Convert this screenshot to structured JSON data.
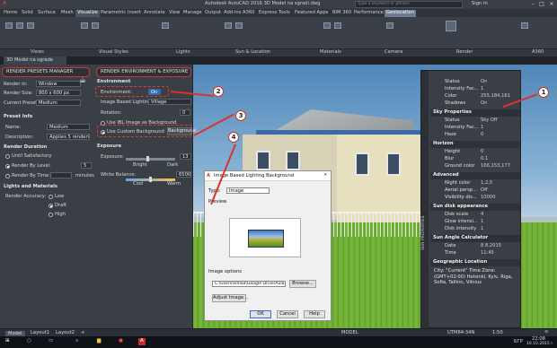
{
  "app": {
    "title": "Autodesk AutoCAD 2016    3D Model na sgradi.dwg",
    "search_placeholder": "Type a keyword or phrase",
    "user": "Sign In"
  },
  "ribbon_tabs": [
    "Home",
    "Solid",
    "Surface",
    "Mesh",
    "Visualize",
    "Parametric",
    "Insert",
    "Annotate",
    "View",
    "Manage",
    "Output",
    "Add-ins",
    "A360",
    "Express Tools",
    "Featured Apps",
    "BIM 360",
    "Performance",
    "Geolocation"
  ],
  "active_tab": "Visualize",
  "ribbon_panels": [
    "Views",
    "Visual Styles",
    "Lights",
    "Sun & Location",
    "Materials",
    "Camera",
    "Render",
    "A360"
  ],
  "doc_tab": "3D Model na sgrade",
  "render_palette": {
    "header_left": "RENDER PRESETS MANAGER",
    "header_right": "RENDER ENVIRONMENT & EXPOSURE",
    "render_in_label": "Render in:",
    "render_in_value": "Window",
    "render_size_label": "Render Size:",
    "render_size_value": "800 x 600 px",
    "current_preset_label": "Current Preset:",
    "current_preset_value": "Medium",
    "preset_info_label": "Preset Info",
    "name_label": "Name:",
    "name_value": "Medium",
    "description_label": "Description:",
    "description_value": "Applies 5 rendering levels",
    "render_duration_label": "Render Duration",
    "until_satisfactory": "Until Satisfactory",
    "render_by_level": "Render By Level:",
    "render_level_value": "5",
    "render_by_time": "Render By Time:",
    "minutes": "minutes",
    "lights_materials_label": "Lights and Materials",
    "render_accuracy_label": "Render Accuracy:",
    "accuracy_low": "Low",
    "accuracy_draft": "Draft",
    "accuracy_high": "High",
    "environment_section": "Environment",
    "environment_label": "Environment:",
    "environment_value": "On",
    "ibl_label": "Image Based Lighting:",
    "ibl_value": "Village",
    "rotation_label": "Rotation:",
    "rotation_value": "0",
    "use_ibl_bg": "Use IBL Image as Background",
    "use_custom_bg": "Use Custom Background",
    "background_button": "Background...",
    "exposure_section": "Exposure",
    "exposure_label": "Exposure:",
    "exposure_value": "13",
    "exposure_bright": "Bright",
    "exposure_dark": "Dark",
    "white_balance_label": "White Balance:",
    "white_balance_value": "6500",
    "wb_cool": "Cool",
    "wb_warm": "Warm"
  },
  "properties": {
    "rows_top": [
      {
        "k": "Status",
        "v": "On"
      },
      {
        "k": "Intensity Fac...",
        "v": "1"
      },
      {
        "k": "Color",
        "v": "255,184,161"
      },
      {
        "k": "Shadows",
        "v": "On"
      }
    ],
    "sky_header": "Sky Properties",
    "sky_rows": [
      {
        "k": "Status",
        "v": "Sky Off"
      },
      {
        "k": "Intensity Fac...",
        "v": "1"
      },
      {
        "k": "Haze",
        "v": "0"
      }
    ],
    "horizon_header": "Horizon",
    "horizon_rows": [
      {
        "k": "Height",
        "v": "0"
      },
      {
        "k": "Blur",
        "v": "0.1"
      },
      {
        "k": "Ground color",
        "v": "166,153,177"
      }
    ],
    "advanced_header": "Advanced",
    "advanced_rows": [
      {
        "k": "Night color",
        "v": "1,2,5"
      },
      {
        "k": "Aerial persp...",
        "v": "Off"
      },
      {
        "k": "Visibility dis...",
        "v": "10000"
      }
    ],
    "sundisk_header": "Sun disk appearance",
    "sundisk_rows": [
      {
        "k": "Disk scale",
        "v": "4"
      },
      {
        "k": "Glow intensi...",
        "v": "1"
      },
      {
        "k": "Disk intensity",
        "v": "1"
      }
    ],
    "sunangle_header": "Sun Angle Calculator",
    "sunangle_rows": [
      {
        "k": "Date",
        "v": "8.8.2015"
      },
      {
        "k": "Time",
        "v": "11:45"
      }
    ],
    "geo_header": "Geographic Location",
    "geo_text": "City: \"Current\"  Time Zone: (GMT+02:00) Helsinki, Kyiv, Riga, Sofia, Tallinn, Vilnius",
    "side_label": "SUN PROPERTIES"
  },
  "dialog": {
    "title": "Image Based Lighting Background",
    "type_label": "Type:",
    "type_value": "Image",
    "preview_label": "Preview",
    "image_options_label": "Image options",
    "path_value": "C:\\Users\\Ismail\\Google Drive\\Aula.bg",
    "browse_button": "Browse...",
    "adjust_button": "Adjust Image...",
    "ok_button": "OK",
    "cancel_button": "Cancel",
    "help_button": "Help"
  },
  "callouts": [
    "1",
    "2",
    "3",
    "4"
  ],
  "status": {
    "model": "MODEL",
    "layout_tabs": [
      "Model",
      "Layout1",
      "Layout2"
    ],
    "coords": "UTM84-34N",
    "scale": "1:50"
  },
  "taskbar": {
    "time": "22:08",
    "date": "10.10.2015 r.",
    "lang": "БГР"
  },
  "colors": {
    "accent": "#e23b33",
    "tab_active": "#4a5562",
    "geo_tab": "#6c7c90"
  }
}
